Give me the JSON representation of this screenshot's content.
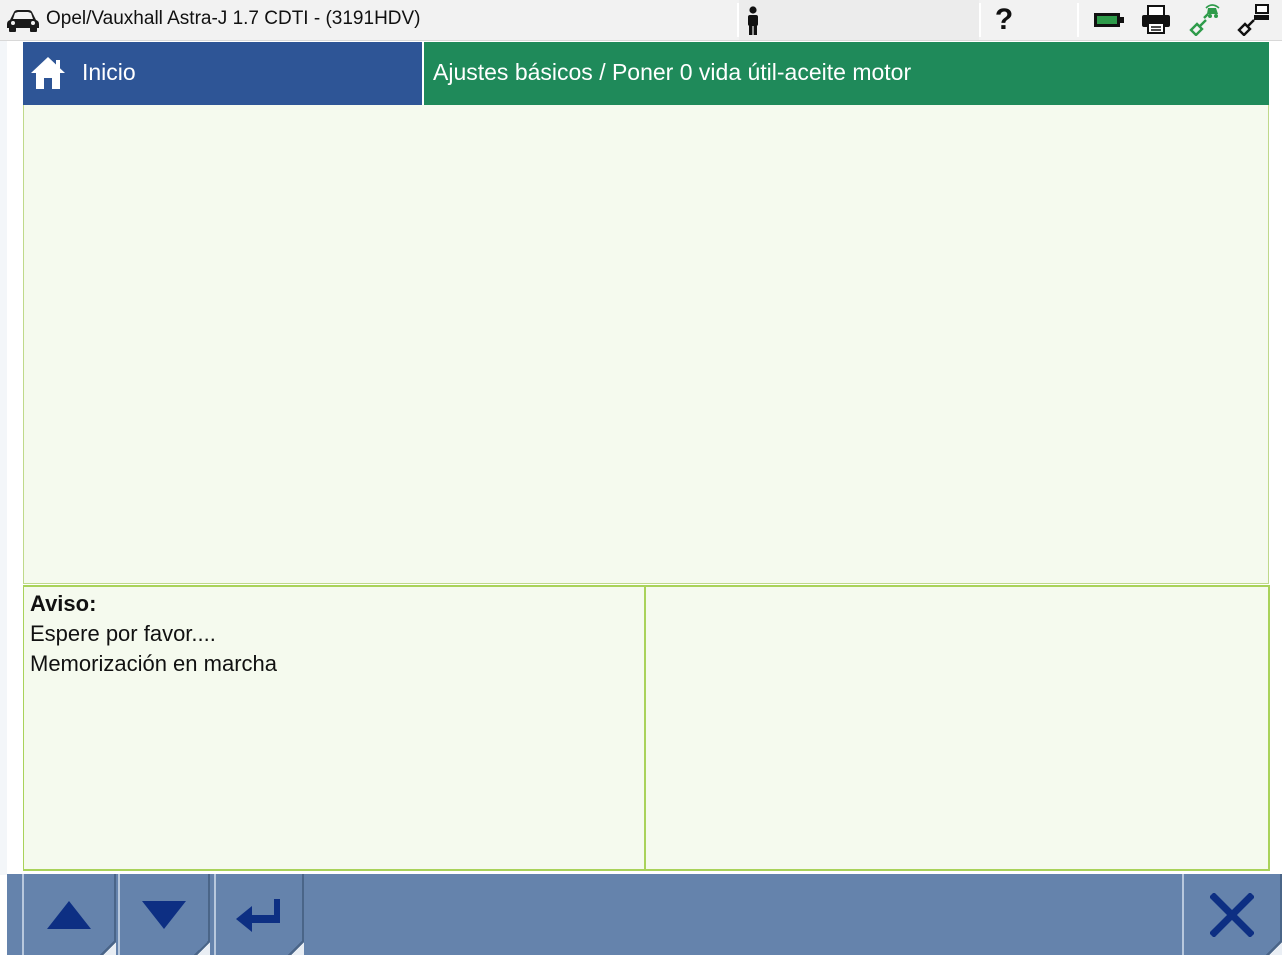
{
  "topbar": {
    "vehicle_title": "Opel/Vauxhall Astra-J 1.7 CDTI - (3191HDV)",
    "help_label": "?",
    "icons": [
      "car-icon",
      "person-icon",
      "help-icon",
      "battery-icon",
      "printer-icon",
      "connection-status-icon",
      "disconnect-icon"
    ]
  },
  "header": {
    "home_label": "Inicio",
    "title": "Ajustes básicos / Poner 0 vida útil-aceite motor"
  },
  "notice": {
    "heading": "Aviso:",
    "lines": [
      "Espere por favor....",
      "Memorización en marcha"
    ]
  },
  "toolbar": {
    "buttons": [
      "arrow-up-icon",
      "arrow-down-icon",
      "enter-icon",
      "close-icon"
    ]
  },
  "colors": {
    "home_tab": "#2e5596",
    "title_bar": "#1f8a5a",
    "panel_bg": "#f5faee",
    "panel_border": "#a9d25a",
    "toolbar": "#6583ac",
    "toolbar_icon": "#0d2f83",
    "connection_green": "#2e9b4a"
  }
}
